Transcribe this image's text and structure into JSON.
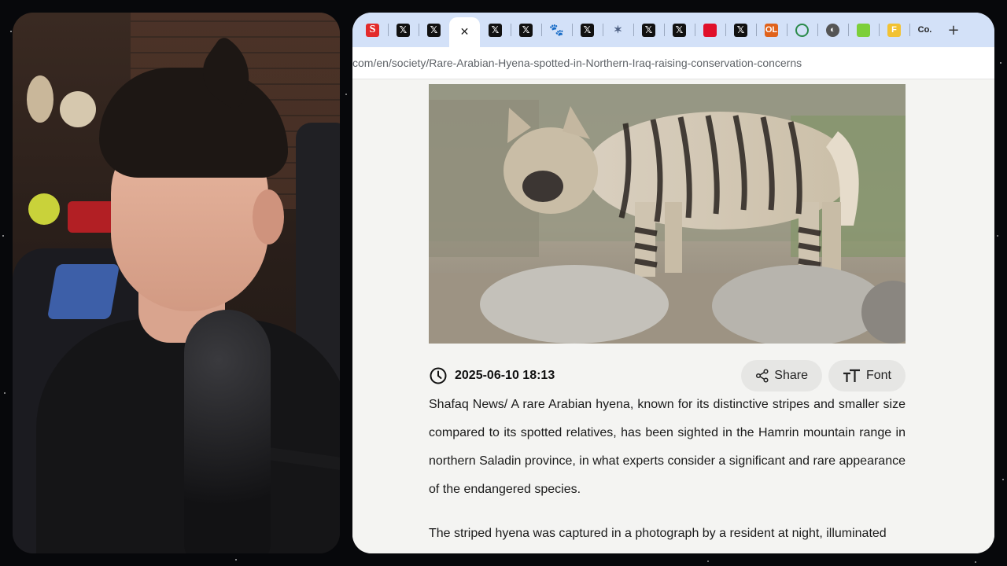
{
  "browser": {
    "tabs": [
      {
        "icon": "S",
        "kind": "s-news-icon"
      },
      {
        "icon": "𝕏",
        "kind": "x-icon"
      },
      {
        "icon": "𝕏",
        "kind": "x-icon"
      },
      {
        "icon": "✕",
        "kind": "close-icon",
        "active": true
      },
      {
        "icon": "𝕏",
        "kind": "x-icon"
      },
      {
        "icon": "𝕏",
        "kind": "x-icon"
      },
      {
        "icon": "🐾",
        "kind": "paw-icon"
      },
      {
        "icon": "𝕏",
        "kind": "x-icon"
      },
      {
        "icon": "✶",
        "kind": "bird-icon"
      },
      {
        "icon": "𝕏",
        "kind": "x-icon"
      },
      {
        "icon": "𝕏",
        "kind": "x-icon"
      },
      {
        "icon": "",
        "kind": "red-square-icon"
      },
      {
        "icon": "𝕏",
        "kind": "x-icon"
      },
      {
        "icon": "OL",
        "kind": "ol-icon"
      },
      {
        "icon": "",
        "kind": "wikipedia-icon"
      },
      {
        "icon": "◐",
        "kind": "globe-icon"
      },
      {
        "icon": "",
        "kind": "green-app-icon"
      },
      {
        "icon": "F",
        "kind": "yellow-app-icon"
      },
      {
        "icon": "Co.",
        "kind": "co-icon"
      }
    ],
    "new_tab_label": "+",
    "url": "com/en/society/Rare-Arabian-Hyena-spotted-in-Northern-Iraq-raising-conservation-concerns"
  },
  "article": {
    "date": "2025-06-10 18:13",
    "share_label": "Share",
    "font_label": "Font",
    "paragraphs": [
      "Shafaq News/ A rare Arabian hyena, known for its distinctive stripes and smaller size compared to its spotted relatives, has been sighted in the Hamrin mountain range in northern Saladin province, in what experts consider a significant and rare appearance of the endangered species.",
      "The striped hyena was captured in a photograph by a resident at night, illuminated"
    ]
  },
  "colors": {
    "tabstrip": "#d3e1f8",
    "page_background": "#f4f4f2",
    "pill_background": "#e6e6e4"
  }
}
